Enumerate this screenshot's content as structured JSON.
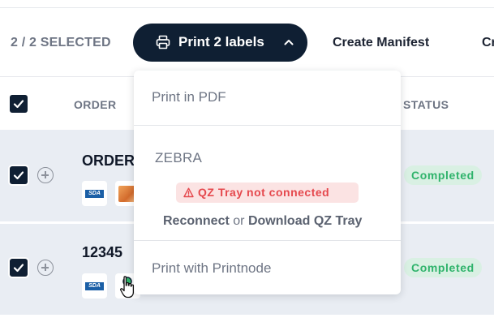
{
  "toolbar": {
    "selection_text": "2 / 2 SELECTED",
    "print_button_label": "Print 2 labels",
    "manifest_label": "Create Manifest",
    "truncated_label": "Cr"
  },
  "table": {
    "headers": {
      "order": "ORDER",
      "status": "STATUS"
    },
    "rows": [
      {
        "order_number": "ORDER",
        "status": "Completed",
        "carrier": "SDA"
      },
      {
        "order_number": "12345",
        "status": "Completed",
        "carrier": "SDA"
      }
    ]
  },
  "print_menu": {
    "pdf_option": "Print in PDF",
    "zebra_label": "ZEBRA",
    "warning": "QZ Tray not connected",
    "reconnect": "Reconnect",
    "or_text": "or",
    "download": "Download QZ Tray",
    "printnode_option": "Print with Printnode"
  },
  "icons": {
    "printer": "printer-icon",
    "chevron": "chevron-up-icon",
    "warning": "warning-triangle-icon",
    "expand": "plus-circle-icon",
    "check": "checkmark-icon"
  },
  "colors": {
    "primary": "#0f1f33",
    "status_bg": "#d9f0e3",
    "status_text": "#2fb36b",
    "warning_bg": "#fbe3e3",
    "warning_text": "#e5484d",
    "row_bg": "#e9edf3"
  }
}
